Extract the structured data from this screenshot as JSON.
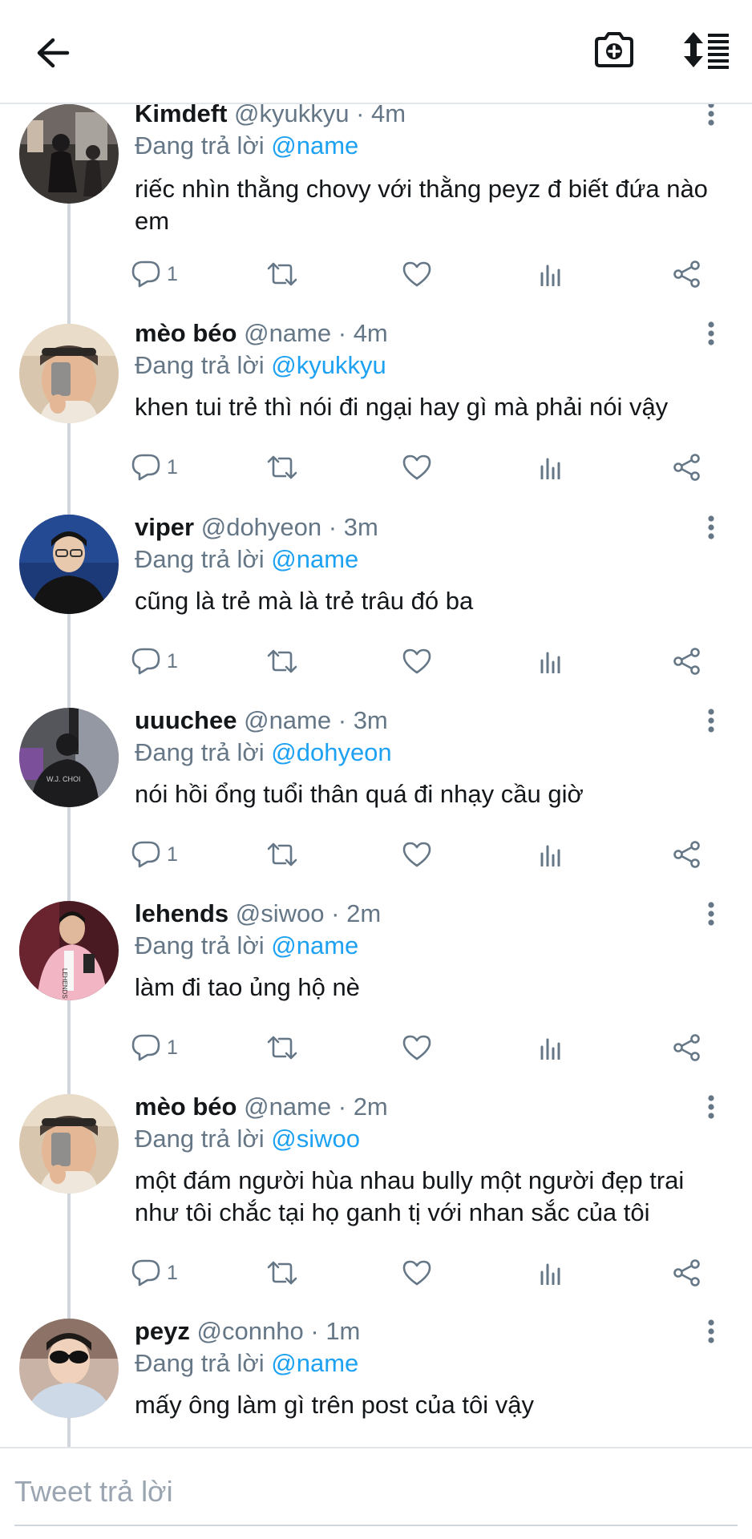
{
  "header": {
    "back_icon": "arrow-left-icon",
    "camera_icon": "camera-plus-icon",
    "sort_icon": "sort-arrows-icon"
  },
  "tweets": [
    {
      "name": "Kimdeft",
      "handle": "@kyukkyu",
      "time": "4m",
      "reply_prefix": "Đang trả lời",
      "reply_to": "@name",
      "text": "riếc nhìn thằng chovy với thằng peyz đ biết đứa nào em",
      "reply_count": "1"
    },
    {
      "name": "mèo béo",
      "handle": "@name",
      "time": "4m",
      "reply_prefix": "Đang trả lời",
      "reply_to": "@kyukkyu",
      "text": "khen tui trẻ thì nói đi ngại hay gì mà phải nói vậy",
      "reply_count": "1"
    },
    {
      "name": "viper",
      "handle": "@dohyeon",
      "time": "3m",
      "reply_prefix": "Đang trả lời",
      "reply_to": "@name",
      "text": "cũng là trẻ mà là trẻ trâu đó ba",
      "reply_count": "1"
    },
    {
      "name": "uuuchee",
      "handle": "@name",
      "time": "3m",
      "reply_prefix": "Đang trả lời",
      "reply_to": "@dohyeon",
      "text": "nói hồi ổng tuổi thân quá đi nhạy cầu giờ",
      "reply_count": "1"
    },
    {
      "name": "lehends",
      "handle": "@siwoo",
      "time": "2m",
      "reply_prefix": "Đang trả lời",
      "reply_to": "@name",
      "text": "làm đi tao ủng hộ nè",
      "reply_count": "1"
    },
    {
      "name": "mèo béo",
      "handle": "@name",
      "time": "2m",
      "reply_prefix": "Đang trả lời",
      "reply_to": "@siwoo",
      "text": "một đám người hùa nhau bully một người đẹp trai như tôi chắc tại họ ganh tị với nhan sắc của tôi",
      "reply_count": "1"
    },
    {
      "name": "peyz",
      "handle": "@connho",
      "time": "1m",
      "reply_prefix": "Đang trả lời",
      "reply_to": "@name",
      "text": "mấy ông làm gì trên post của tôi vậy"
    }
  ],
  "compose": {
    "placeholder": "Tweet trả lời"
  },
  "colors": {
    "accent": "#1da1f2",
    "muted": "#657786",
    "text": "#14171a",
    "thread_line": "#d0d6dc"
  }
}
